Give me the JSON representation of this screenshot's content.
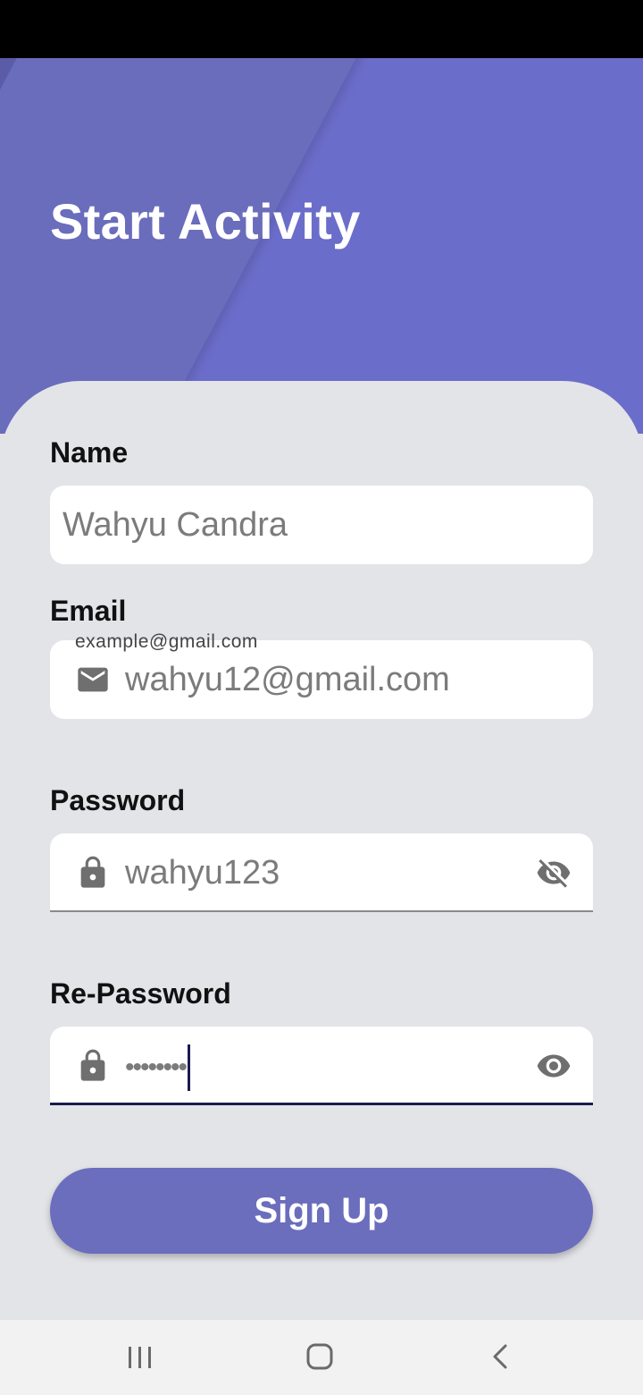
{
  "app": {
    "title": "Start Activity"
  },
  "form": {
    "name": {
      "label": "Name",
      "value": "Wahyu Candra"
    },
    "email": {
      "label": "Email",
      "hint": "example@gmail.com",
      "value": "wahyu12@gmail.com",
      "icon": "email-icon"
    },
    "password": {
      "label": "Password",
      "value": "wahyu123",
      "icon": "lock-icon",
      "toggle_icon": "eye-off-icon"
    },
    "repassword": {
      "label": "Re-Password",
      "value": "••••••••",
      "icon": "lock-icon",
      "toggle_icon": "eye-icon"
    },
    "submit_label": "Sign Up"
  },
  "navigation": {
    "recents": "recents-icon",
    "home": "home-icon",
    "back": "back-icon"
  },
  "colors": {
    "header": "#6b6dca",
    "button": "#6b6dbd",
    "background": "#e3e4e8",
    "focus_underline": "#1a1a52"
  }
}
